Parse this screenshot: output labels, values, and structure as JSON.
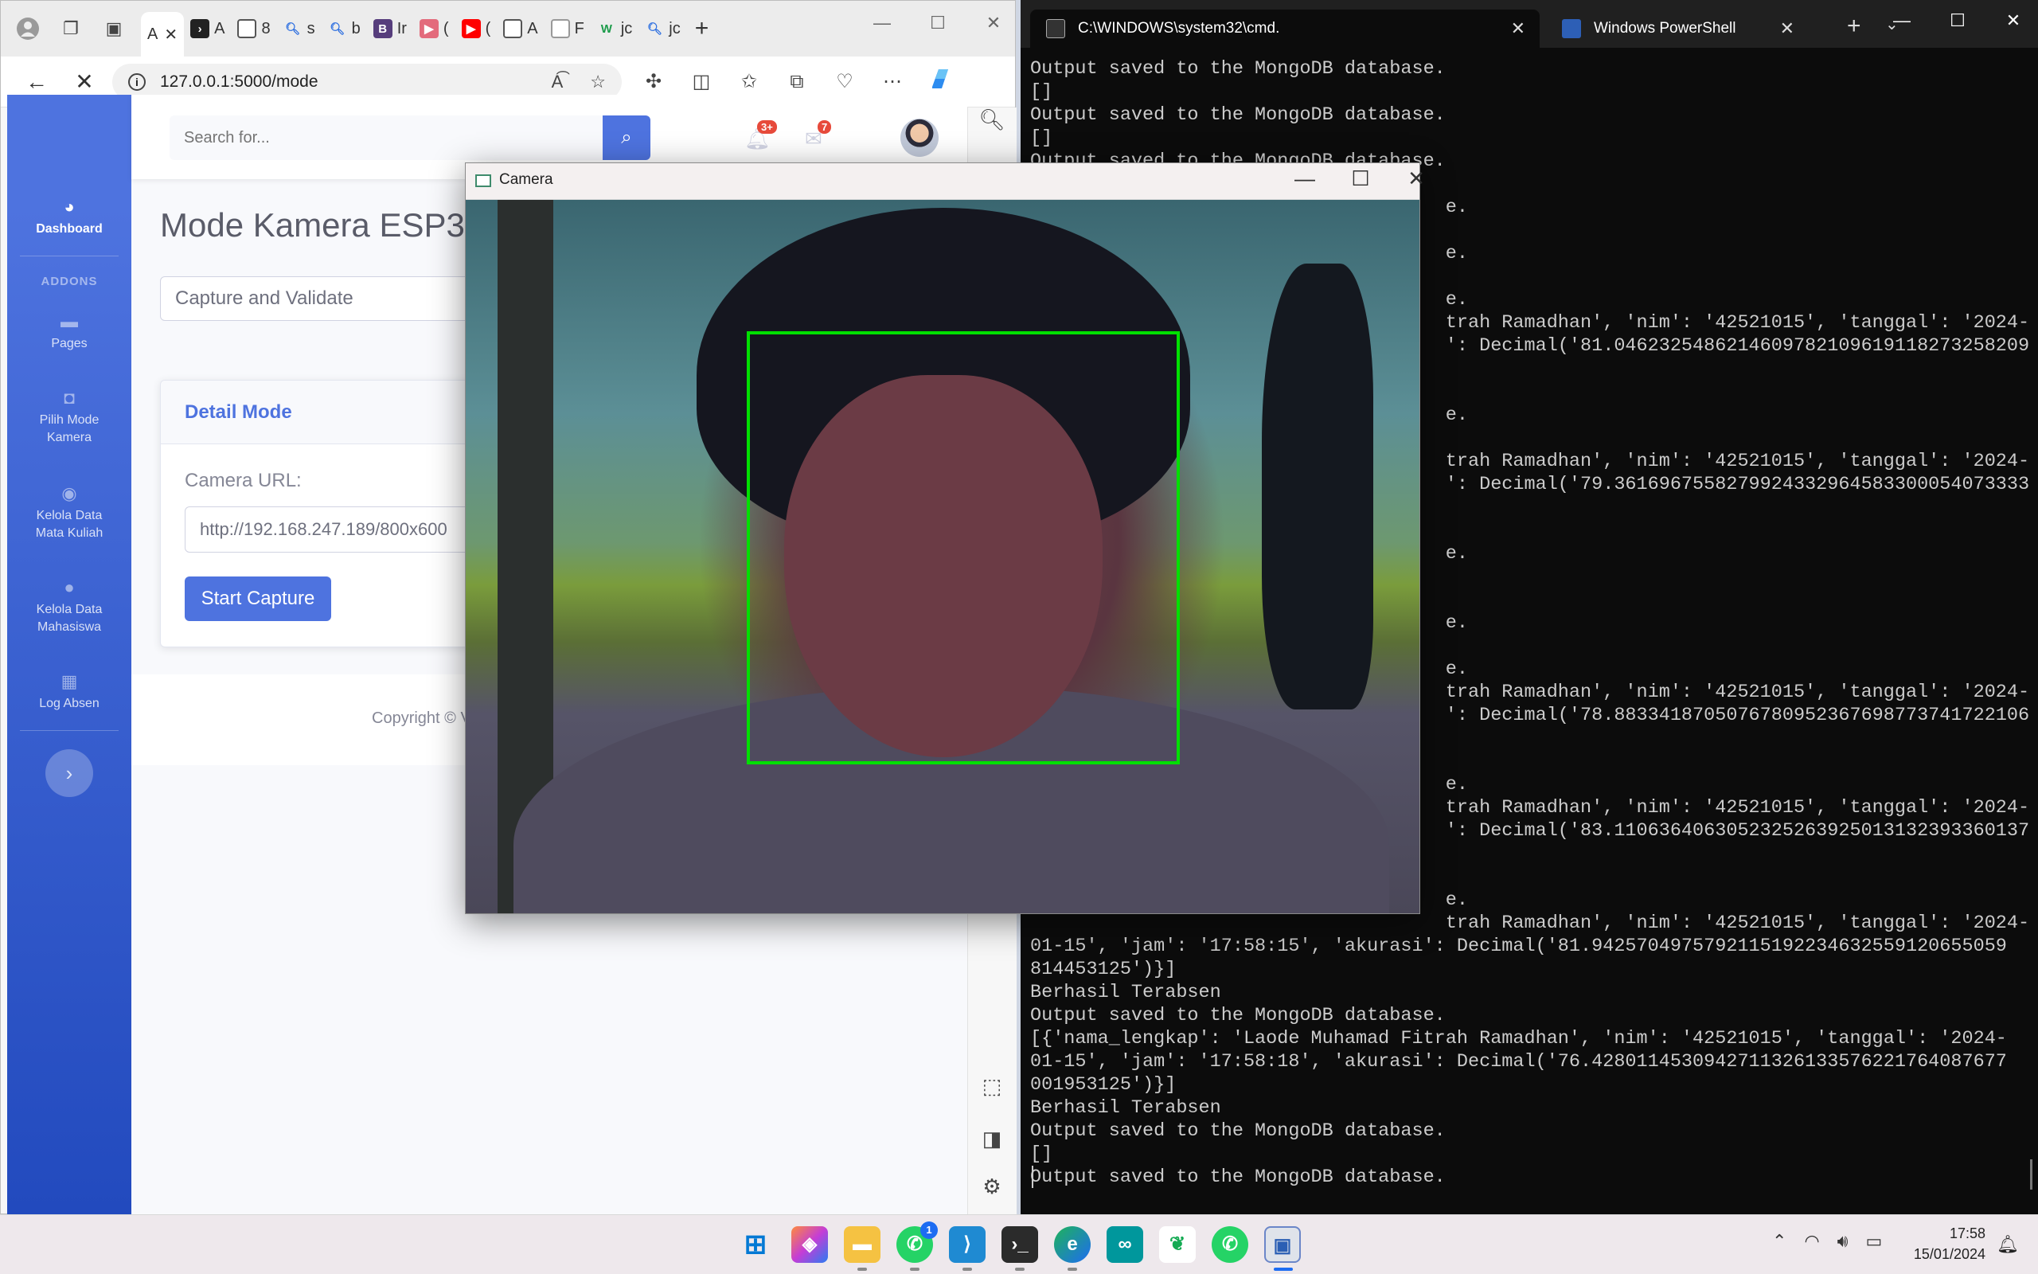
{
  "browser": {
    "tabs": [
      {
        "label": "A",
        "active": true
      },
      {
        "label": "A"
      },
      {
        "label": "8"
      },
      {
        "label": "s"
      },
      {
        "label": "b"
      },
      {
        "label": "Ir"
      },
      {
        "label": "("
      },
      {
        "label": "("
      },
      {
        "label": "A"
      },
      {
        "label": "F"
      },
      {
        "label": "jc"
      },
      {
        "label": "jc"
      }
    ],
    "url": "127.0.0.1:5000/mode"
  },
  "app": {
    "search_placeholder": "Search for...",
    "alerts_badge": "3+",
    "messages_badge": "7",
    "sidebar": {
      "dashboard": "Dashboard",
      "heading": "ADDONS",
      "items": [
        "Pages",
        "Pilih Mode Kamera",
        "Kelola Data Mata Kuliah",
        "Kelola Data Mahasiswa",
        "Log Absen"
      ]
    },
    "page_title": "Mode Kamera ESP32",
    "mode_select": "Capture and Validate",
    "card_title": "Detail Mode",
    "camera_label": "Camera URL:",
    "camera_url": "http://192.168.247.189/800x600",
    "start_button": "Start Capture",
    "footer": "Copyright © V"
  },
  "terminal": {
    "tab_cmd": "C:\\WINDOWS\\system32\\cmd.",
    "tab_ps": "Windows PowerShell",
    "lines": [
      "Output saved to the MongoDB database.",
      "[]",
      "Output saved to the MongoDB database.",
      "[]",
      "Output saved to the MongoDB database.",
      "",
      "                                     e.",
      "",
      "                                     e.",
      "",
      "                                     e.",
      "                                     trah Ramadhan', 'nim': '42521015', 'tanggal': '2024-",
      "                                     ': Decimal('81.0462325486214609782109619118273258209",
      "",
      "",
      "                                     e.",
      "",
      "                                     trah Ramadhan', 'nim': '42521015', 'tanggal': '2024-",
      "                                     ': Decimal('79.3616967558279924332964583300054073333",
      "",
      "",
      "                                     e.",
      "",
      "",
      "                                     e.",
      "",
      "                                     e.",
      "                                     trah Ramadhan', 'nim': '42521015', 'tanggal': '2024-",
      "                                     ': Decimal('78.8833418705076780952367698773741722106",
      "",
      "",
      "                                     e.",
      "                                     trah Ramadhan', 'nim': '42521015', 'tanggal': '2024-",
      "                                     ': Decimal('83.1106364063052325263925013132393360137",
      "",
      "",
      "                                     e.",
      "                                     trah Ramadhan', 'nim': '42521015', 'tanggal': '2024-",
      "01-15', 'jam': '17:58:15', 'akurasi': Decimal('81.9425704975792115192234632559120655059",
      "814453125')}]",
      "Berhasil Terabsen",
      "Output saved to the MongoDB database.",
      "[{'nama_lengkap': 'Laode Muhamad Fitrah Ramadhan', 'nim': '42521015', 'tanggal': '2024-",
      "01-15', 'jam': '17:58:18', 'akurasi': Decimal('76.4280114530942711326133576221764087677",
      "001953125')}]",
      "Berhasil Terabsen",
      "Output saved to the MongoDB database.",
      "[]",
      "Output saved to the MongoDB database."
    ]
  },
  "camera_window": {
    "title": "Camera"
  },
  "taskbar": {
    "whatsapp_badge": "1",
    "time": "17:58",
    "date": "15/01/2024"
  }
}
